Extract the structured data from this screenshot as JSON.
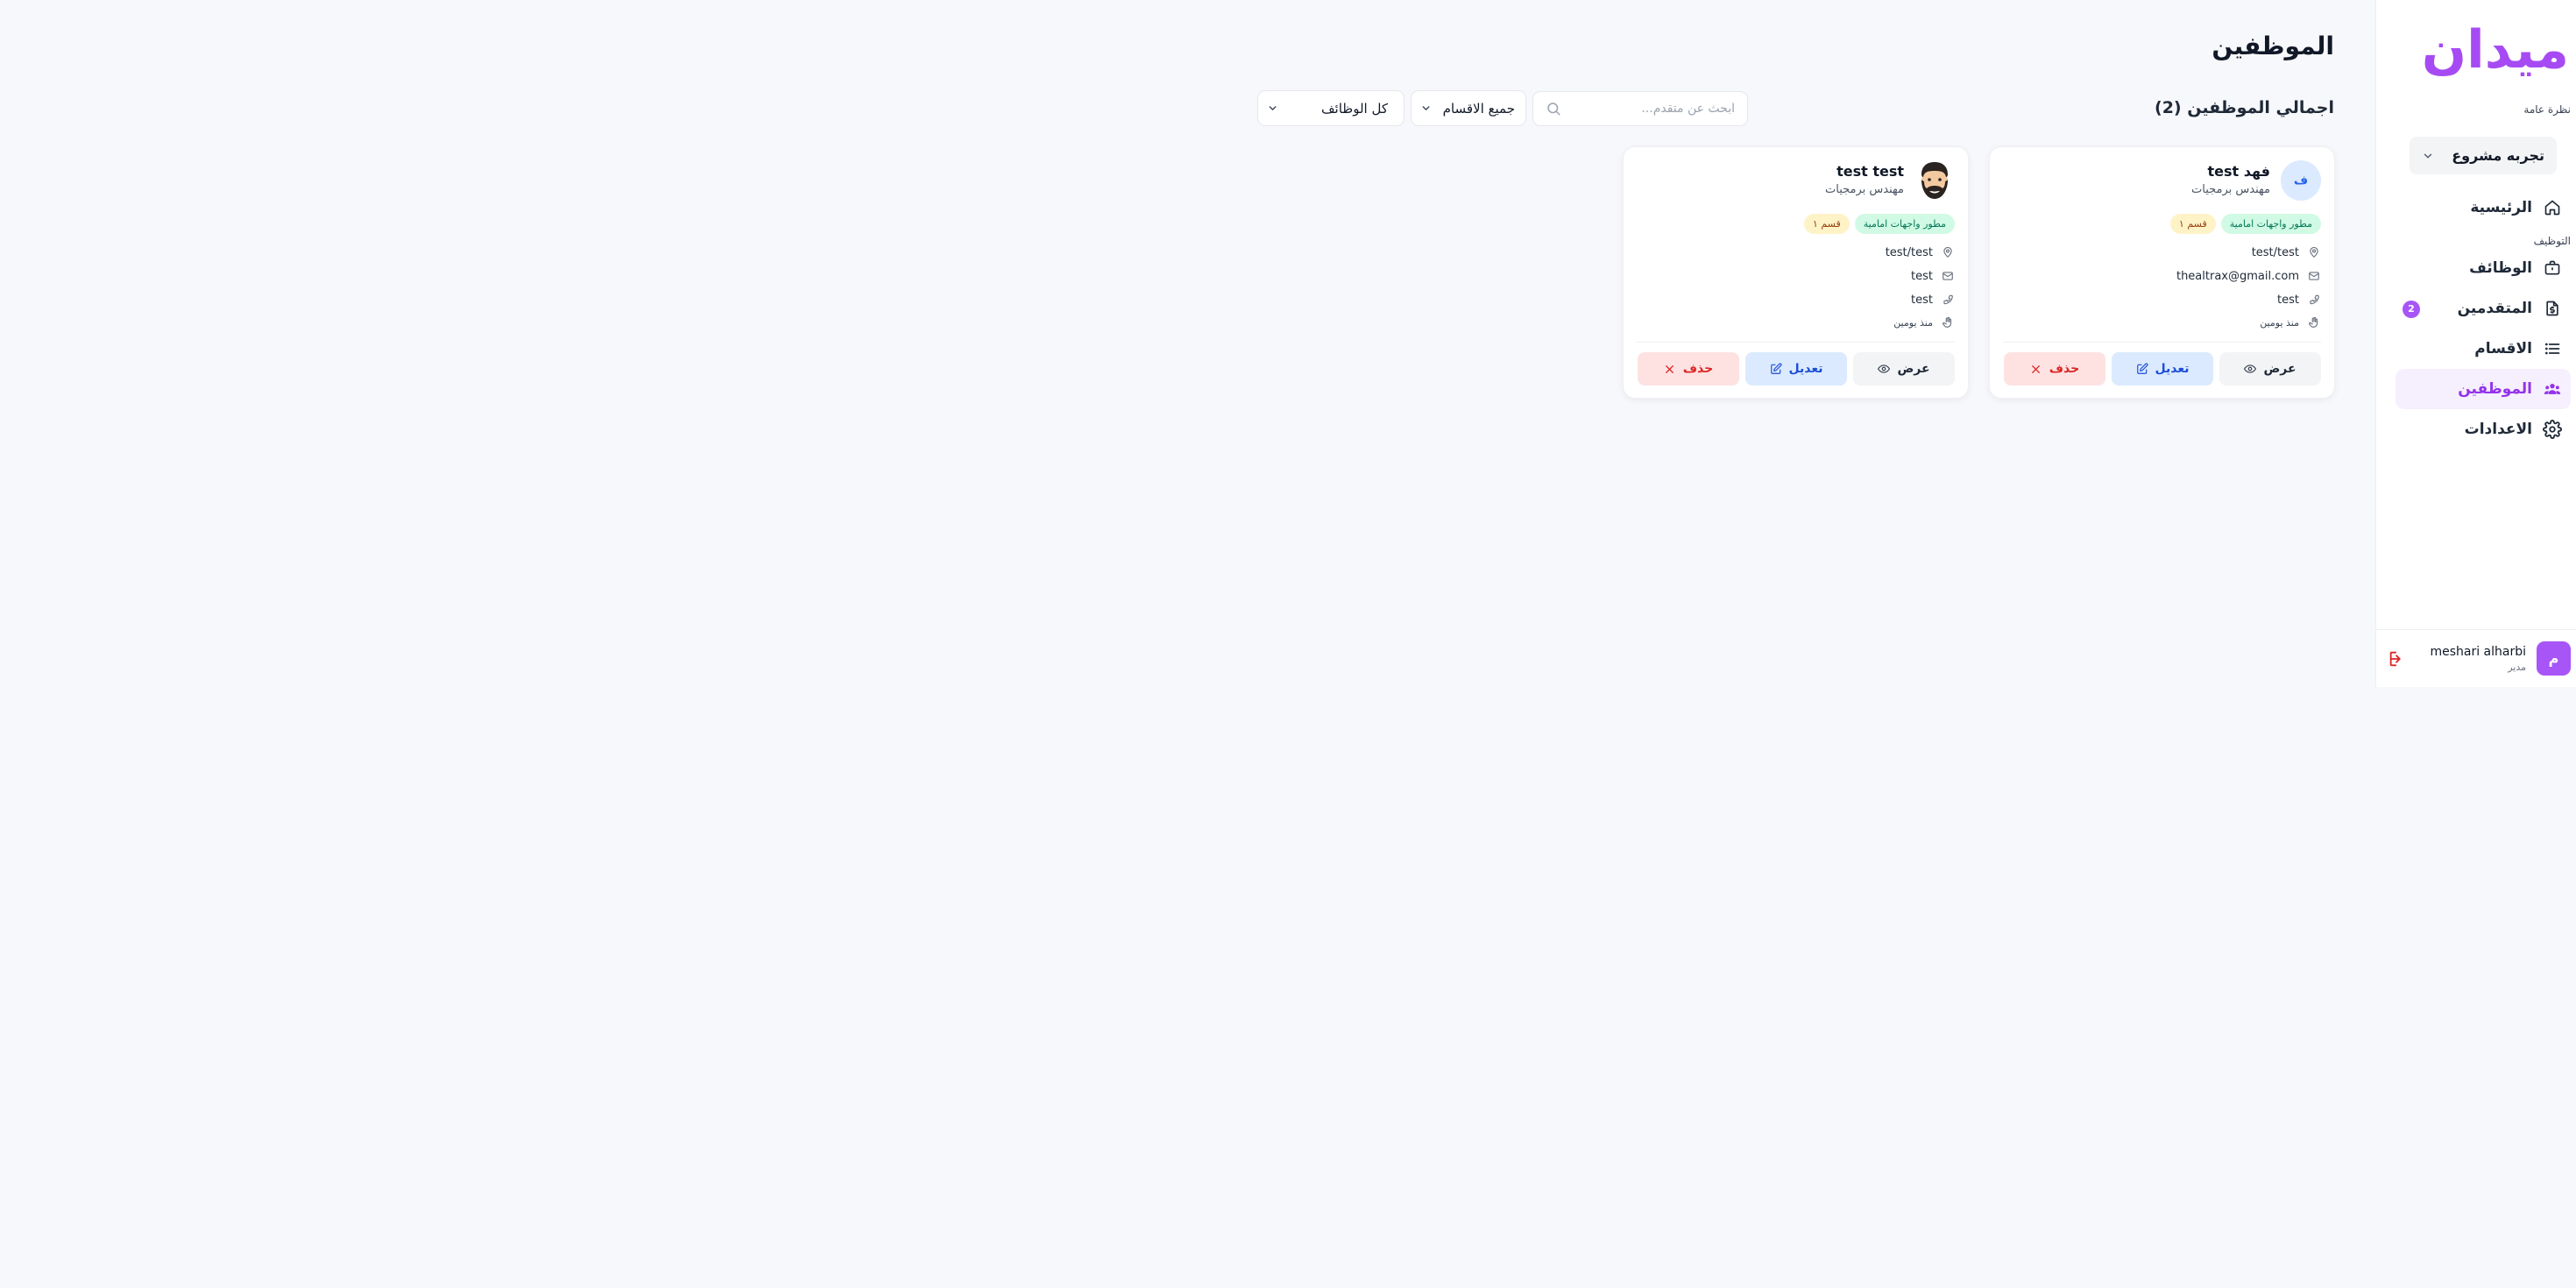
{
  "sidebar": {
    "logo_text": "ميدان",
    "overview_label": "نظرة عامة",
    "project_select": "تجربه مشروع",
    "section_hiring": "التوظيف",
    "items": [
      {
        "label": "الرئيسية",
        "icon": "home-icon"
      },
      {
        "label": "الوظائف",
        "icon": "briefcase-icon"
      },
      {
        "label": "المتقدمين",
        "icon": "file-dollar-icon",
        "badge": "2"
      },
      {
        "label": "الاقسام",
        "icon": "list-icon"
      },
      {
        "label": "الموظفين",
        "icon": "users-icon",
        "active": true
      },
      {
        "label": "الاعدادات",
        "icon": "gear-icon"
      }
    ],
    "user": {
      "initial": "م",
      "name": "meshari alharbi",
      "role": "مدير"
    }
  },
  "header": {
    "title": "الموظفين",
    "total_label": "اجمالي الموظفين (2)",
    "search_placeholder": "ابحث عن متقدم...",
    "department_filter": "جميع الاقسام",
    "jobs_filter": "كل الوظائف"
  },
  "employees": [
    {
      "avatar_letter": "ف",
      "name": "فهد test",
      "role": "مهندس برمجيات",
      "tags": [
        "مطور واجهات امامية",
        "قسم ١"
      ],
      "location": "test/test",
      "email": "thealtrax@gmail.com",
      "phone": "test",
      "joined": "منذ يومين"
    },
    {
      "avatar_emoji": "🧔🏻",
      "name": "test test",
      "role": "مهندس برمجيات",
      "tags": [
        "مطور واجهات امامية",
        "قسم ١"
      ],
      "location": "test/test",
      "email": "test",
      "phone": "test",
      "joined": "منذ يومين"
    }
  ],
  "actions": {
    "view": "عرض",
    "edit": "تعديل",
    "delete": "حذف"
  },
  "colors": {
    "accent": "#a855f7",
    "brand": "#a64bf4",
    "danger": "#dc2626",
    "info": "#1d4ed8"
  }
}
